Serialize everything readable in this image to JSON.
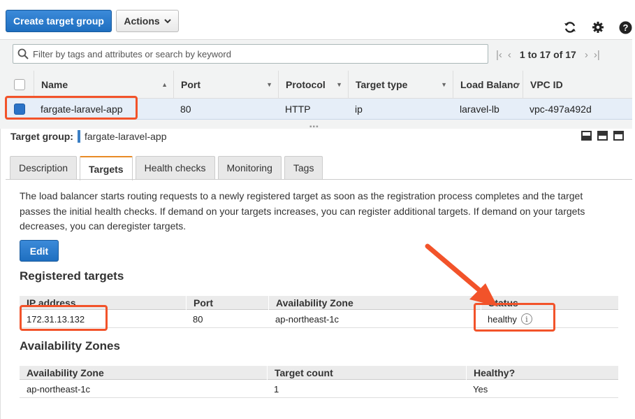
{
  "toolbar": {
    "create_label": "Create target group",
    "actions_label": "Actions",
    "refresh_icon": "refresh-icon",
    "settings_icon": "gear-icon",
    "help_icon": "help-icon"
  },
  "filter": {
    "placeholder": "Filter by tags and attributes or search by keyword"
  },
  "pager": {
    "range": "1 to 17 of 17"
  },
  "grid": {
    "columns": [
      "Name",
      "Port",
      "Protocol",
      "Target type",
      "Load Balanc",
      "VPC ID"
    ],
    "selected_row": {
      "name": "fargate-laravel-app",
      "port": "80",
      "protocol": "HTTP",
      "target_type": "ip",
      "load_balancer": "laravel-lb",
      "vpc_id": "vpc-497a492d"
    }
  },
  "detail": {
    "label": "Target group:",
    "name": "fargate-laravel-app"
  },
  "tabs": [
    "Description",
    "Targets",
    "Health checks",
    "Monitoring",
    "Tags"
  ],
  "targets": {
    "description": "The load balancer starts routing requests to a newly registered target as soon as the registration process completes and the target passes the initial health checks. If demand on your targets increases, you can register additional targets. If demand on your targets decreases, you can deregister targets.",
    "edit_label": "Edit",
    "registered_title": "Registered targets",
    "registered_columns": [
      "IP address",
      "Port",
      "Availability Zone",
      "Status"
    ],
    "registered_row": {
      "ip": "172.31.13.132",
      "port": "80",
      "zone": "ap-northeast-1c",
      "status": "healthy"
    },
    "az_title": "Availability Zones",
    "az_columns": [
      "Availability Zone",
      "Target count",
      "Healthy?"
    ],
    "az_row": {
      "zone": "ap-northeast-1c",
      "count": "1",
      "healthy": "Yes"
    }
  },
  "colors": {
    "primary": "#1f6fc0",
    "annotation": "#f2532a",
    "selected_row": "#e6eef8"
  }
}
